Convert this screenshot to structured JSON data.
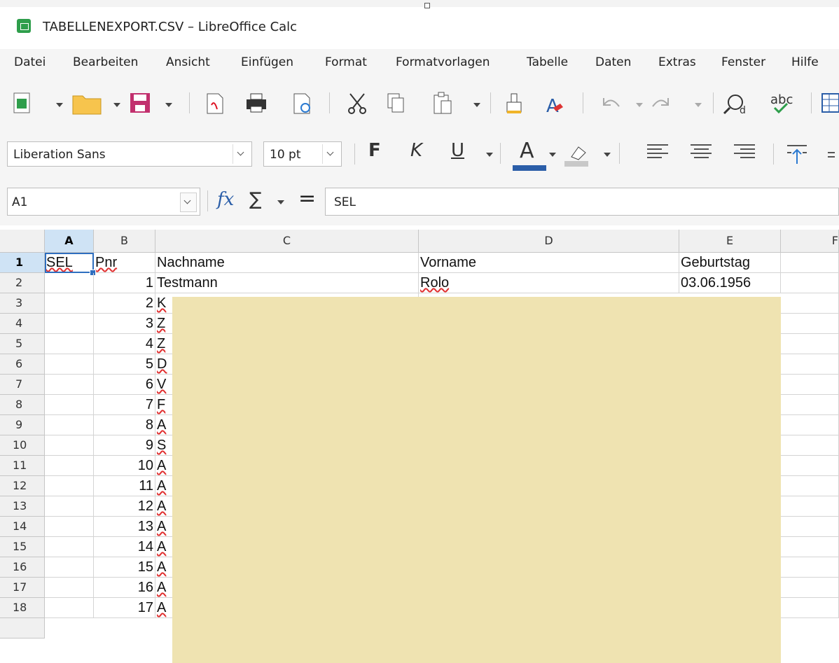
{
  "window": {
    "title": "TABELLENEXPORT.CSV – LibreOffice Calc"
  },
  "menu": [
    "Datei",
    "Bearbeiten",
    "Ansicht",
    "Einfügen",
    "Format",
    "Formatvorlagen",
    "Tabelle",
    "Daten",
    "Extras",
    "Fenster",
    "Hilfe"
  ],
  "toolbar": {
    "icons": [
      "new-spreadsheet-icon",
      "open-folder-icon",
      "save-icon",
      "export-pdf-icon",
      "print-icon",
      "print-preview-icon",
      "cut-icon",
      "copy-icon",
      "paste-icon",
      "clone-formatting-icon",
      "clear-formatting-icon",
      "undo-icon",
      "redo-icon",
      "find-replace-icon",
      "spellcheck-icon",
      "insert-table-icon"
    ],
    "spell_label": "abc"
  },
  "format_bar": {
    "font_name": "Liberation Sans",
    "font_size": "10 pt",
    "bold": "F",
    "italic": "K",
    "underline": "U",
    "font_color_letter": "A",
    "font_color": "#2b5ea8"
  },
  "formula_bar": {
    "name_box": "A1",
    "fx": "fx",
    "sigma": "∑",
    "equals": "=",
    "content": "SEL"
  },
  "columns": [
    "A",
    "B",
    "C",
    "D",
    "E",
    "F"
  ],
  "rows": [
    "1",
    "2",
    "3",
    "4",
    "5",
    "6",
    "7",
    "8",
    "9",
    "10",
    "11",
    "12",
    "13",
    "14",
    "15",
    "16",
    "17",
    "18"
  ],
  "cells": {
    "header_row": [
      "SEL",
      "Pnr",
      "Nachname",
      "Vorname",
      "Geburtstag"
    ],
    "row2": [
      "",
      "1",
      "Testmann",
      "Rolo",
      "03.06.1956"
    ],
    "pnr": [
      "2",
      "3",
      "4",
      "5",
      "6",
      "7",
      "8",
      "9",
      "10",
      "11",
      "12",
      "13",
      "14",
      "15",
      "16",
      "17"
    ],
    "initials": [
      "K",
      "Z",
      "Z",
      "D",
      "V",
      "F",
      "A",
      "S",
      "A",
      "A",
      "A",
      "A",
      "A",
      "A",
      "A",
      "A"
    ]
  },
  "colors": {
    "selection": "#2e6fc0",
    "redaction": "#efe3b1",
    "app_icon": "#2e9e4b"
  }
}
